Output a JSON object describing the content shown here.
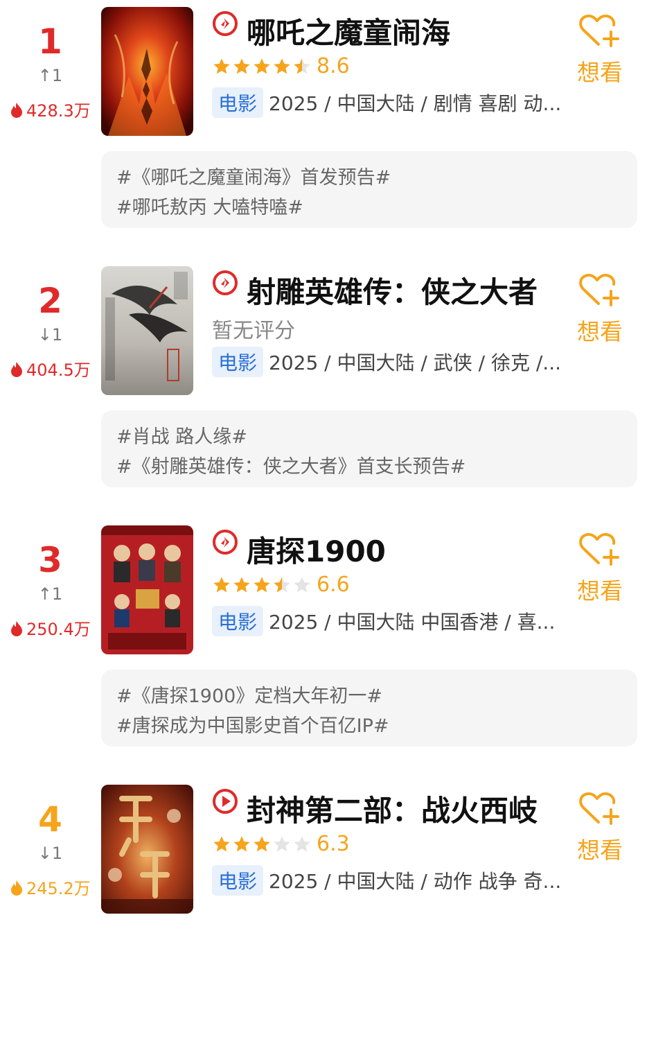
{
  "movies": [
    {
      "rank": "1",
      "rank_color": "red",
      "trend": "↑1",
      "heat": "428.3万",
      "title": "哪吒之魔童闹海",
      "rating_stars": 4.5,
      "score": "8.6",
      "tag": "电影",
      "meta": "2025 / 中国大陆 / 剧情 喜剧 动...",
      "want_label": "想看",
      "topics": [
        "#《哪吒之魔童闹海》首发预告#",
        "#哪吒敖丙 大嗑特嗑#"
      ]
    },
    {
      "rank": "2",
      "rank_color": "red",
      "trend": "↓1",
      "heat": "404.5万",
      "title": "射雕英雄传：侠之大者",
      "no_score": "暂无评分",
      "tag": "电影",
      "meta": "2025 / 中国大陆 / 武侠 / 徐克 /...",
      "want_label": "想看",
      "topics": [
        "#肖战 路人缘#",
        "#《射雕英雄传：侠之大者》首支长预告#"
      ]
    },
    {
      "rank": "3",
      "rank_color": "red",
      "trend": "↑1",
      "heat": "250.4万",
      "title": "唐探1900",
      "rating_stars": 3.5,
      "score": "6.6",
      "tag": "电影",
      "meta": "2025 / 中国大陆 中国香港 / 喜...",
      "want_label": "想看",
      "topics": [
        "#《唐探1900》定档大年初一#",
        "#唐探成为中国影史首个百亿IP#"
      ]
    },
    {
      "rank": "4",
      "rank_color": "orange",
      "trend": "↓1",
      "heat": "245.2万",
      "title": "封神第二部：战火西岐",
      "rating_stars": 3,
      "score": "6.3",
      "tag": "电影",
      "meta": "2025 / 中国大陆 / 动作 战争 奇...",
      "want_label": "想看"
    }
  ],
  "colors": {
    "accent_red": "#e02a2a",
    "accent_orange": "#f5a41b",
    "tag_blue": "#2a6fd6"
  },
  "icons": {
    "heat": "flame-icon",
    "play": "play-circle-icon",
    "want": "heart-plus-icon",
    "star": "star-icon"
  }
}
